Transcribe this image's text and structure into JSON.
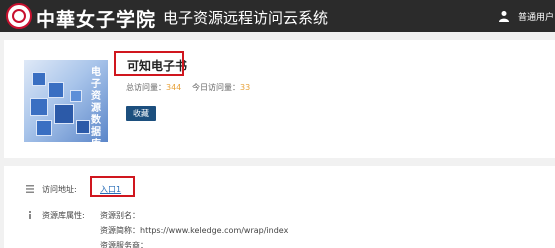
{
  "header": {
    "logo_text": "中華女子学院",
    "app_title": "电子资源远程访问云系统",
    "user_label": "普通用户"
  },
  "database": {
    "cover_text": "电子资源数据库",
    "title": "可知电子书",
    "total_visits_label": "总访问量：",
    "total_visits": "344",
    "today_visits_label": "今日访问量：",
    "today_visits": "33",
    "favorite_label": "收藏"
  },
  "access": {
    "address_label": "访问地址:",
    "entry_link": "入口1",
    "properties_label": "资源库属性:",
    "alias": "资源别名：",
    "short_name": "资源简称：https://www.keledge.com/wrap/index",
    "service": "资源服务商："
  },
  "colors": {
    "header_bg": "#2b2b2b",
    "accent": "#1c4f7e",
    "highlight": "#d0161e",
    "stat_number": "#e8a23a",
    "link": "#2a6eb8"
  }
}
